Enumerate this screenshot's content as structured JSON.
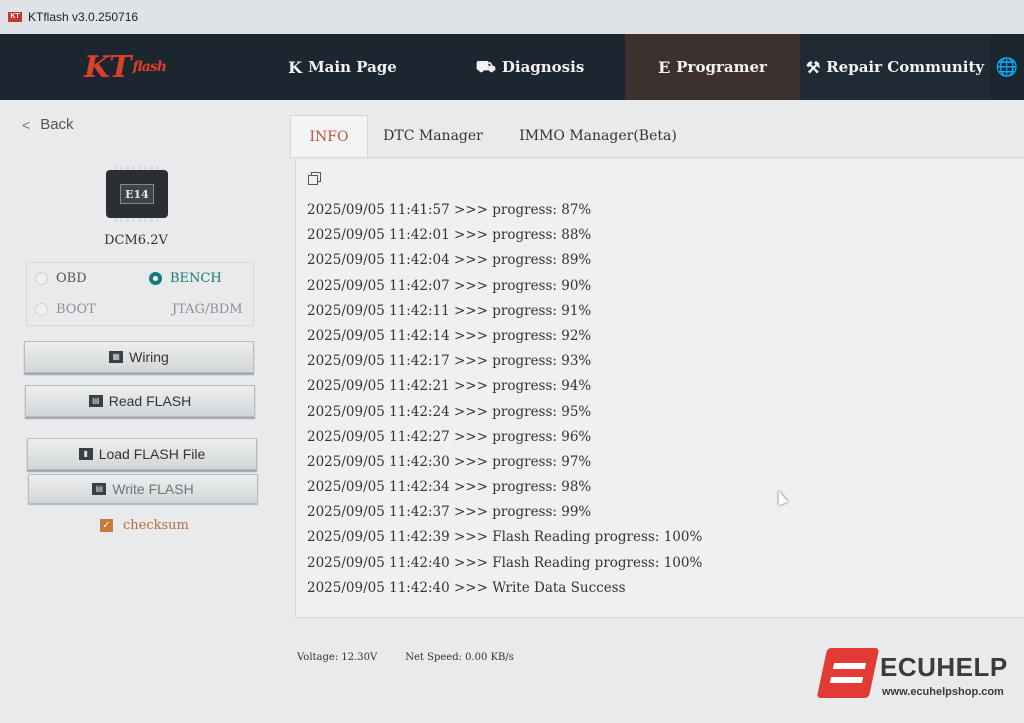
{
  "window": {
    "title": "KTflash v3.0.250716",
    "icon_label": "KT"
  },
  "topnav": {
    "logo_text": "KT",
    "logo_sub": "flash",
    "items": [
      {
        "label": "Main Page",
        "icon": "K"
      },
      {
        "label": "Diagnosis",
        "icon": "⛟"
      },
      {
        "label": "Programer",
        "icon": "E"
      },
      {
        "label": "Repair Community",
        "icon": "⚒"
      }
    ],
    "globe_icon": "🌐"
  },
  "sidebar": {
    "back_label": "Back",
    "chip_label": "E14",
    "ecu_name": "DCM6.2V",
    "modes": [
      {
        "label": "OBD",
        "selected": false
      },
      {
        "label": "BENCH",
        "selected": true
      },
      {
        "label": "BOOT",
        "selected": false
      },
      {
        "label": "JTAG/BDM",
        "selected": false
      }
    ],
    "buttons": {
      "wiring": "Wiring",
      "read_flash": "Read FLASH",
      "load_flash_file": "Load FLASH File",
      "write_flash": "Write FLASH"
    },
    "checksum_label": "checksum",
    "checksum_checked": true
  },
  "tabs": [
    {
      "label": "INFO",
      "active": true
    },
    {
      "label": "DTC Manager",
      "active": false
    },
    {
      "label": "IMMO Manager(Beta)",
      "active": false
    }
  ],
  "log": [
    "2025/09/05 11:41:57 >>> progress: 87%",
    "2025/09/05 11:42:01 >>> progress: 88%",
    "2025/09/05 11:42:04 >>> progress: 89%",
    "2025/09/05 11:42:07 >>> progress: 90%",
    "2025/09/05 11:42:11 >>> progress: 91%",
    "2025/09/05 11:42:14 >>> progress: 92%",
    "2025/09/05 11:42:17 >>> progress: 93%",
    "2025/09/05 11:42:21 >>> progress: 94%",
    "2025/09/05 11:42:24 >>> progress: 95%",
    "2025/09/05 11:42:27 >>> progress: 96%",
    "2025/09/05 11:42:30 >>> progress: 97%",
    "2025/09/05 11:42:34 >>> progress: 98%",
    "2025/09/05 11:42:37 >>> progress: 99%",
    "2025/09/05 11:42:39 >>> Flash Reading progress: 100%",
    "2025/09/05 11:42:40 >>> Flash Reading progress: 100%",
    "2025/09/05 11:42:40 >>> Write Data Success"
  ],
  "status": {
    "voltage": "Voltage:  12.30V",
    "net_speed": "Net Speed:  0.00 KB/s"
  },
  "watermark": {
    "brand": "ECUHELP",
    "url": "www.ecuhelpshop.com"
  },
  "colors": {
    "nav_bg": "#1c2630",
    "active_nav_bg": "#3d3130",
    "accent_teal": "#147b7a",
    "active_tab_text": "#c0523a",
    "checksum_orange": "#c67a3c",
    "logo_red": "#d9412b"
  }
}
